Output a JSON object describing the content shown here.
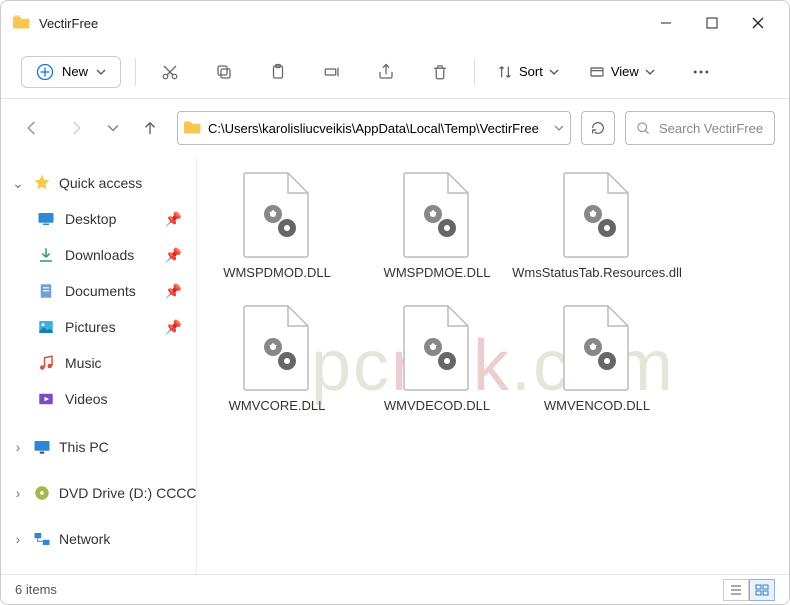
{
  "window": {
    "title": "VectirFree"
  },
  "toolbar": {
    "new_label": "New",
    "sort_label": "Sort",
    "view_label": "View"
  },
  "address": {
    "path": "C:\\Users\\karolisliucveikis\\AppData\\Local\\Temp\\VectirFree"
  },
  "search": {
    "placeholder": "Search VectirFree"
  },
  "nav": {
    "quick_access": "Quick access",
    "items": [
      "Desktop",
      "Downloads",
      "Documents",
      "Pictures",
      "Music",
      "Videos"
    ],
    "this_pc": "This PC",
    "dvd": "DVD Drive (D:) CCCC",
    "network": "Network"
  },
  "files": [
    {
      "name": "WMSPDMOD.DLL"
    },
    {
      "name": "WMSPDMOE.DLL"
    },
    {
      "name": "WmsStatusTab.Resources.dll"
    },
    {
      "name": "WMVCORE.DLL"
    },
    {
      "name": "WMVDECOD.DLL"
    },
    {
      "name": "WMVENCOD.DLL"
    }
  ],
  "status": {
    "count": "6 items"
  },
  "watermark": {
    "a": "pc",
    "b": "risk",
    "c": ".com"
  }
}
